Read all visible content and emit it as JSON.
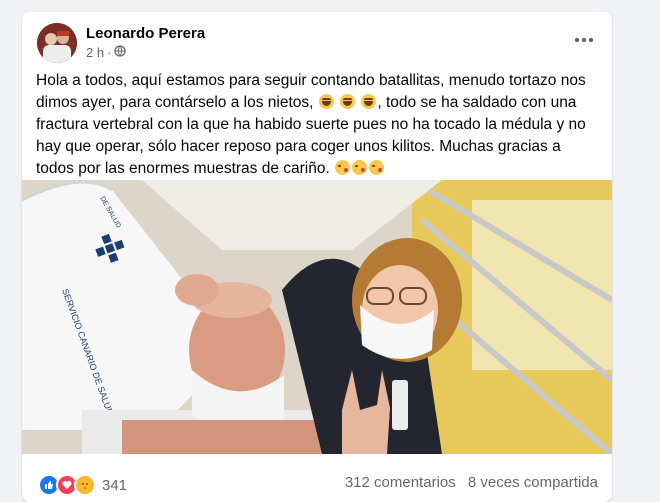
{
  "post": {
    "author": "Leonardo Perera",
    "time": "2 h",
    "separator": "·",
    "privacy_icon": "globe-icon",
    "more_icon": "more-options-icon",
    "text_part1": "Hola a todos, aquí estamos para seguir contando batallitas, menudo tortazo nos dimos ayer, para contárselo a los nietos, ",
    "text_part2": ", todo se ha saldado con una fractura vertebral con la que ha habido suerte pues no ha tocado la médula y no hay que operar, sólo hacer reposo para coger unos kilitos. Muchas gracias a todos por las enormes muestras de cariño. ",
    "emojis_laugh": [
      "laughing-emoji",
      "laughing-emoji",
      "laughing-emoji"
    ],
    "emojis_kiss": [
      "kissing-heart-emoji",
      "kissing-heart-emoji",
      "kissing-heart-emoji"
    ]
  },
  "photo": {
    "pillow_text": "SERVICIO CANARIO DE SALUD",
    "pillow_text_small": "DE SALUD"
  },
  "footer": {
    "reaction_icons": [
      "like-icon",
      "love-icon",
      "care-icon"
    ],
    "reaction_count": "341",
    "comments": "312 comentarios",
    "shares": "8 veces compartida"
  },
  "colors": {
    "accent": "#1877f2",
    "love": "#f33e58",
    "text": "#050505",
    "secondary_text": "#65676b"
  }
}
